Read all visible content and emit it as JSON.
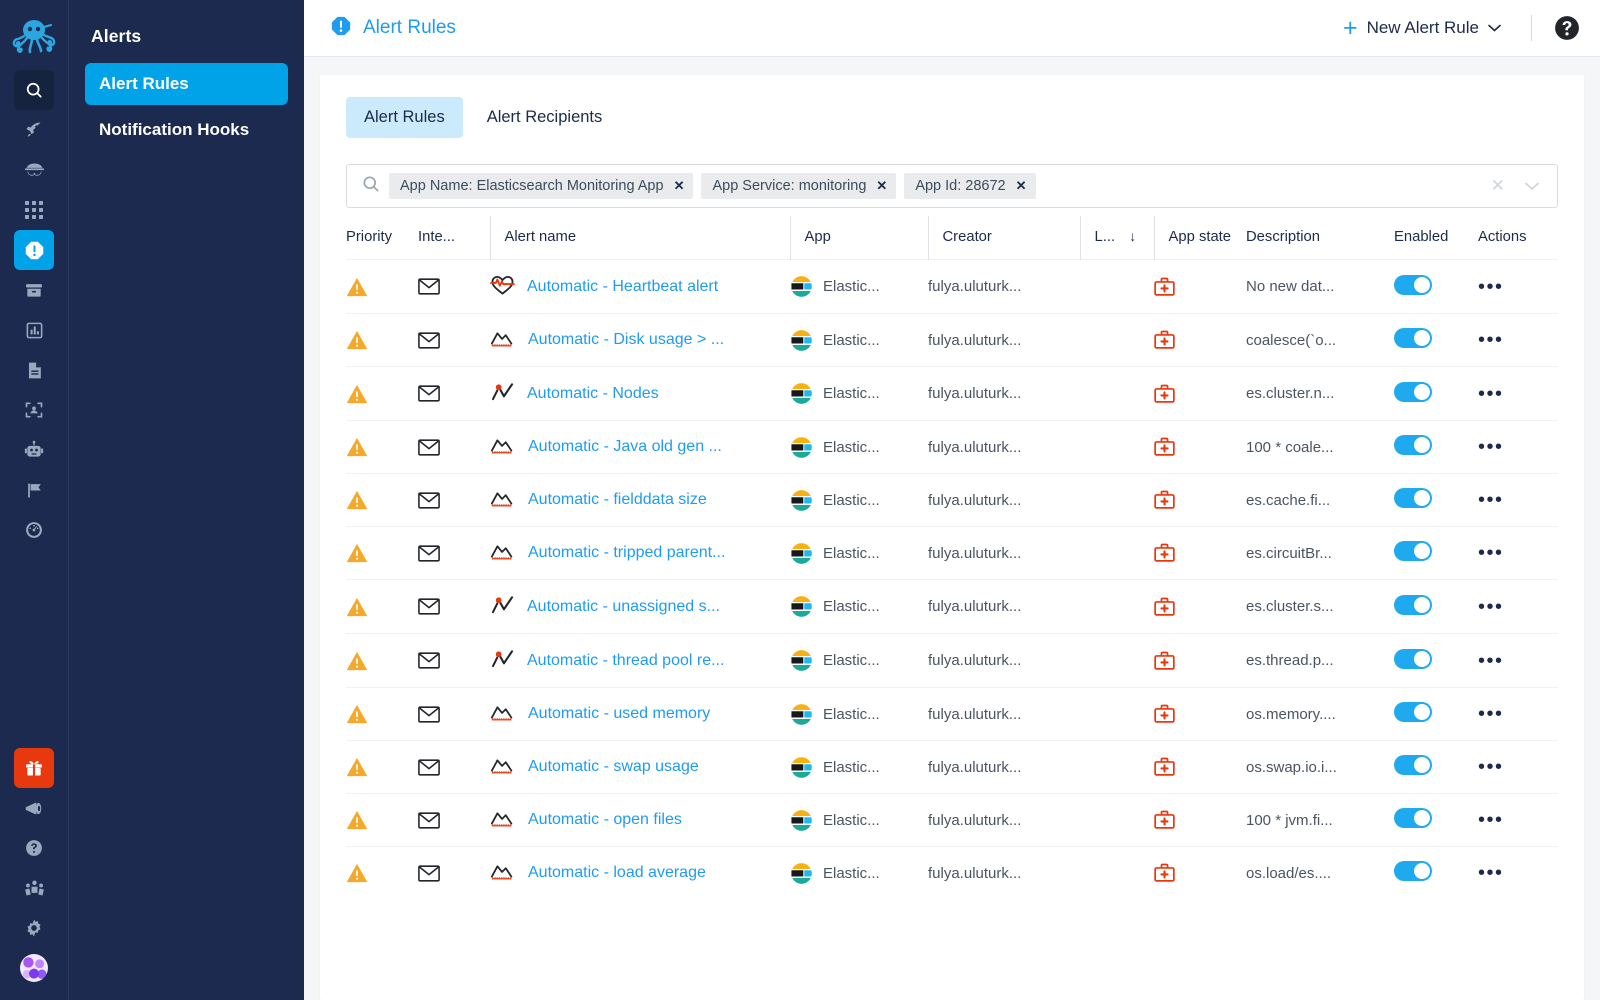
{
  "brand": {
    "logo_icon": "octopus-logo",
    "accent": "#00a3e8",
    "dark_bg": "#1b2a4e"
  },
  "rail": {
    "items": [
      {
        "icon": "search-icon",
        "state": "selected-dark"
      },
      {
        "icon": "rocket-icon",
        "state": "normal"
      },
      {
        "icon": "spy-icon",
        "state": "normal"
      },
      {
        "icon": "grid-icon",
        "state": "normal"
      },
      {
        "icon": "alert-icon",
        "state": "selected-blue"
      },
      {
        "icon": "archive-icon",
        "state": "normal"
      },
      {
        "icon": "bar-chart-icon",
        "state": "normal"
      },
      {
        "icon": "document-icon",
        "state": "normal"
      },
      {
        "icon": "image-scan-icon",
        "state": "normal"
      },
      {
        "icon": "robot-icon",
        "state": "normal"
      },
      {
        "icon": "flag-icon",
        "state": "normal"
      },
      {
        "icon": "speedometer-icon",
        "state": "normal"
      }
    ],
    "bottom": [
      {
        "icon": "gift-icon",
        "state": "gift"
      },
      {
        "icon": "megaphone-icon",
        "state": "normal"
      },
      {
        "icon": "help-circle-icon",
        "state": "normal"
      },
      {
        "icon": "community-icon",
        "state": "normal"
      },
      {
        "icon": "gear-icon",
        "state": "normal"
      }
    ],
    "avatar": "user-avatar"
  },
  "sidebar": {
    "title": "Alerts",
    "items": [
      {
        "label": "Alert Rules",
        "active": true
      },
      {
        "label": "Notification Hooks",
        "active": false
      }
    ]
  },
  "topbar": {
    "icon": "alert-octagon-icon",
    "title": "Alert Rules",
    "new_rule_label": "New Alert Rule",
    "plus_glyph": "+",
    "caret_glyph": "⌄",
    "help_icon": "help-circle-icon"
  },
  "tabs": [
    {
      "label": "Alert Rules",
      "active": true
    },
    {
      "label": "Alert Recipients",
      "active": false
    }
  ],
  "search": {
    "icon": "search-icon",
    "placeholder": "",
    "chips": [
      {
        "label": "App Name: Elasticsearch Monitoring App",
        "remove": "✕"
      },
      {
        "label": "App Service: monitoring",
        "remove": "✕"
      },
      {
        "label": "App Id: 28672",
        "remove": "✕"
      }
    ],
    "clear_all": "✕",
    "expand": "⌄"
  },
  "table": {
    "columns": [
      {
        "key": "priority",
        "label": "Priority"
      },
      {
        "key": "interaction",
        "label": "Inte..."
      },
      {
        "key": "name",
        "label": "Alert name"
      },
      {
        "key": "app",
        "label": "App"
      },
      {
        "key": "creator",
        "label": "Creator"
      },
      {
        "key": "l",
        "label": "L...",
        "sorted": true,
        "sort_glyph": "↓"
      },
      {
        "key": "app_state",
        "label": "App state"
      },
      {
        "key": "description",
        "label": "Description"
      },
      {
        "key": "enabled",
        "label": "Enabled"
      },
      {
        "key": "actions",
        "label": "Actions"
      }
    ],
    "rows": [
      {
        "priority_icon": "warning-triangle-icon",
        "interaction_icon": "envelope-icon",
        "type_icon": "heartbeat-icon",
        "name": "Automatic - Heartbeat alert",
        "app": "Elastic...",
        "creator": "fulya.uluturk...",
        "app_state_icon": "first-aid-kit-icon",
        "description": "No new dat...",
        "enabled": true,
        "actions_glyph": "•••"
      },
      {
        "priority_icon": "warning-triangle-icon",
        "interaction_icon": "envelope-icon",
        "type_icon": "area-chart-icon",
        "name": "Automatic - Disk usage > ...",
        "app": "Elastic...",
        "creator": "fulya.uluturk...",
        "app_state_icon": "first-aid-kit-icon",
        "description": "coalesce(`o...",
        "enabled": true,
        "actions_glyph": "•••"
      },
      {
        "priority_icon": "warning-triangle-icon",
        "interaction_icon": "envelope-icon",
        "type_icon": "anomaly-icon",
        "name": "Automatic - Nodes",
        "app": "Elastic...",
        "creator": "fulya.uluturk...",
        "app_state_icon": "first-aid-kit-icon",
        "description": "es.cluster.n...",
        "enabled": true,
        "actions_glyph": "•••"
      },
      {
        "priority_icon": "warning-triangle-icon",
        "interaction_icon": "envelope-icon",
        "type_icon": "area-chart-icon",
        "name": "Automatic - Java old gen ...",
        "app": "Elastic...",
        "creator": "fulya.uluturk...",
        "app_state_icon": "first-aid-kit-icon",
        "description": "100 * coale...",
        "enabled": true,
        "actions_glyph": "•••"
      },
      {
        "priority_icon": "warning-triangle-icon",
        "interaction_icon": "envelope-icon",
        "type_icon": "area-chart-icon",
        "name": "Automatic - fielddata size",
        "app": "Elastic...",
        "creator": "fulya.uluturk...",
        "app_state_icon": "first-aid-kit-icon",
        "description": "es.cache.fi...",
        "enabled": true,
        "actions_glyph": "•••"
      },
      {
        "priority_icon": "warning-triangle-icon",
        "interaction_icon": "envelope-icon",
        "type_icon": "area-chart-icon",
        "name": "Automatic - tripped parent...",
        "app": "Elastic...",
        "creator": "fulya.uluturk...",
        "app_state_icon": "first-aid-kit-icon",
        "description": "es.circuitBr...",
        "enabled": true,
        "actions_glyph": "•••"
      },
      {
        "priority_icon": "warning-triangle-icon",
        "interaction_icon": "envelope-icon",
        "type_icon": "anomaly-icon",
        "name": "Automatic - unassigned s...",
        "app": "Elastic...",
        "creator": "fulya.uluturk...",
        "app_state_icon": "first-aid-kit-icon",
        "description": "es.cluster.s...",
        "enabled": true,
        "actions_glyph": "•••"
      },
      {
        "priority_icon": "warning-triangle-icon",
        "interaction_icon": "envelope-icon",
        "type_icon": "anomaly-icon",
        "name": "Automatic - thread pool re...",
        "app": "Elastic...",
        "creator": "fulya.uluturk...",
        "app_state_icon": "first-aid-kit-icon",
        "description": "es.thread.p...",
        "enabled": true,
        "actions_glyph": "•••"
      },
      {
        "priority_icon": "warning-triangle-icon",
        "interaction_icon": "envelope-icon",
        "type_icon": "area-chart-icon",
        "name": "Automatic - used memory",
        "app": "Elastic...",
        "creator": "fulya.uluturk...",
        "app_state_icon": "first-aid-kit-icon",
        "description": "os.memory....",
        "enabled": true,
        "actions_glyph": "•••"
      },
      {
        "priority_icon": "warning-triangle-icon",
        "interaction_icon": "envelope-icon",
        "type_icon": "area-chart-icon",
        "name": "Automatic - swap usage",
        "app": "Elastic...",
        "creator": "fulya.uluturk...",
        "app_state_icon": "first-aid-kit-icon",
        "description": "os.swap.io.i...",
        "enabled": true,
        "actions_glyph": "•••"
      },
      {
        "priority_icon": "warning-triangle-icon",
        "interaction_icon": "envelope-icon",
        "type_icon": "area-chart-icon",
        "name": "Automatic - open files",
        "app": "Elastic...",
        "creator": "fulya.uluturk...",
        "app_state_icon": "first-aid-kit-icon",
        "description": "100 * jvm.fi...",
        "enabled": true,
        "actions_glyph": "•••"
      },
      {
        "priority_icon": "warning-triangle-icon",
        "interaction_icon": "envelope-icon",
        "type_icon": "area-chart-icon",
        "name": "Automatic - load average",
        "app": "Elastic...",
        "creator": "fulya.uluturk...",
        "app_state_icon": "first-aid-kit-icon",
        "description": "os.load/es....",
        "enabled": true,
        "actions_glyph": "•••"
      }
    ]
  }
}
